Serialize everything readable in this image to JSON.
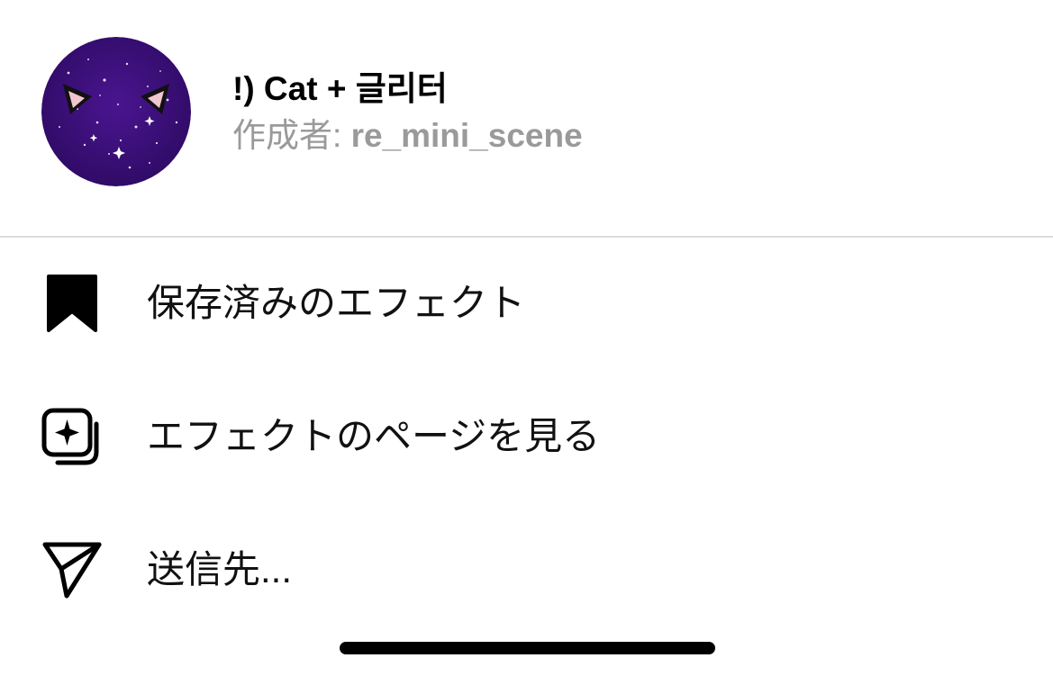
{
  "effect": {
    "title": "!) Cat + 글리터",
    "creator_prefix": "作成者: ",
    "creator_name": "re_mini_scene"
  },
  "menu": {
    "items": [
      {
        "label": "保存済みのエフェクト",
        "icon": "bookmark-icon"
      },
      {
        "label": "エフェクトのページを見る",
        "icon": "effect-page-icon"
      },
      {
        "label": "送信先...",
        "icon": "send-icon"
      }
    ]
  },
  "colors": {
    "avatar_background": "#3d0f78",
    "secondary_text": "#9a9a9a",
    "divider": "#dcdcdc"
  }
}
